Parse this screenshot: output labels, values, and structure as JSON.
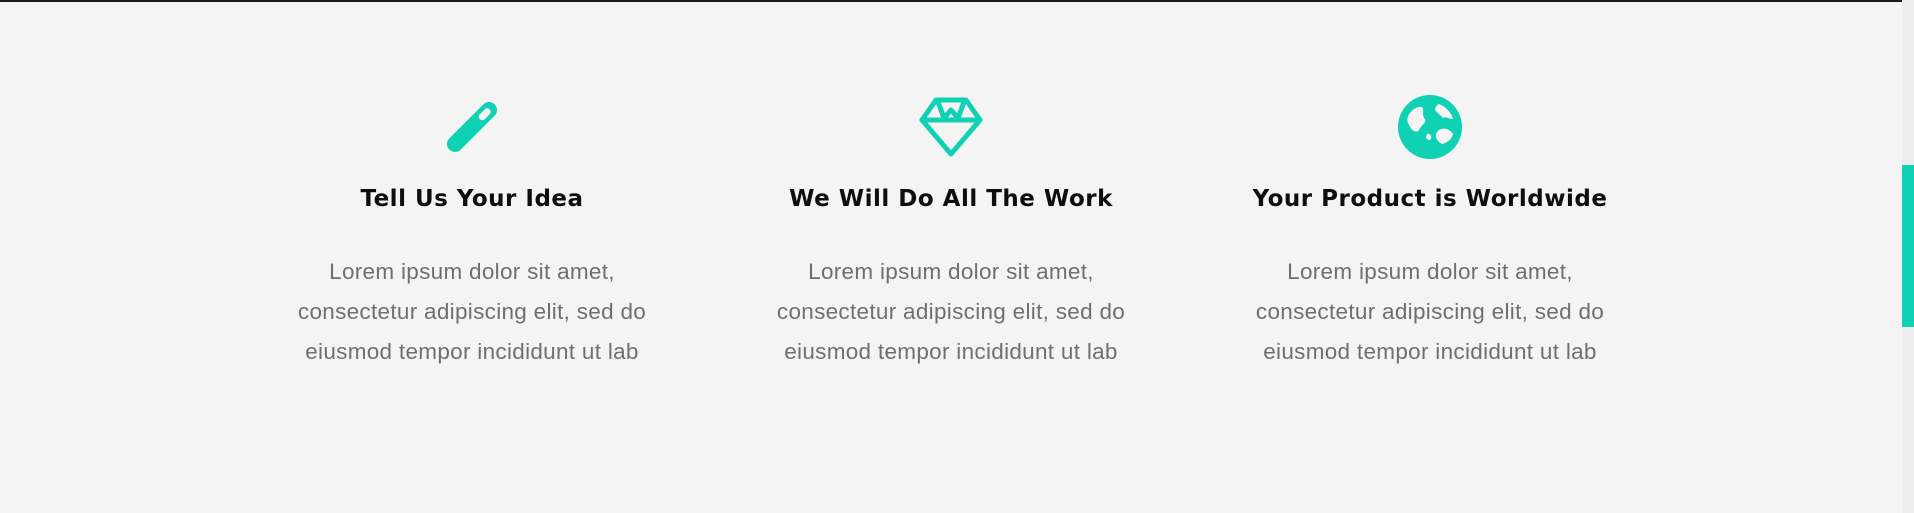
{
  "theme": {
    "accent": "#0fd1b4",
    "background": "#f4f4f4",
    "heading_color": "#0e0e0e",
    "body_color": "#6f6f6f"
  },
  "features": [
    {
      "icon": "magic-wand-icon",
      "title": "Tell Us Your Idea",
      "body": "Lorem ipsum dolor sit amet, consectetur adipiscing elit, sed do eiusmod tempor incididunt ut lab"
    },
    {
      "icon": "diamond-icon",
      "title": "We Will Do All The Work",
      "body": "Lorem ipsum dolor sit amet, consectetur adipiscing elit, sed do eiusmod tempor incididunt ut lab"
    },
    {
      "icon": "globe-icon",
      "title": "Your Product is Worldwide",
      "body": "Lorem ipsum dolor sit amet, consectetur adipiscing elit, sed do eiusmod tempor incididunt ut lab"
    }
  ]
}
